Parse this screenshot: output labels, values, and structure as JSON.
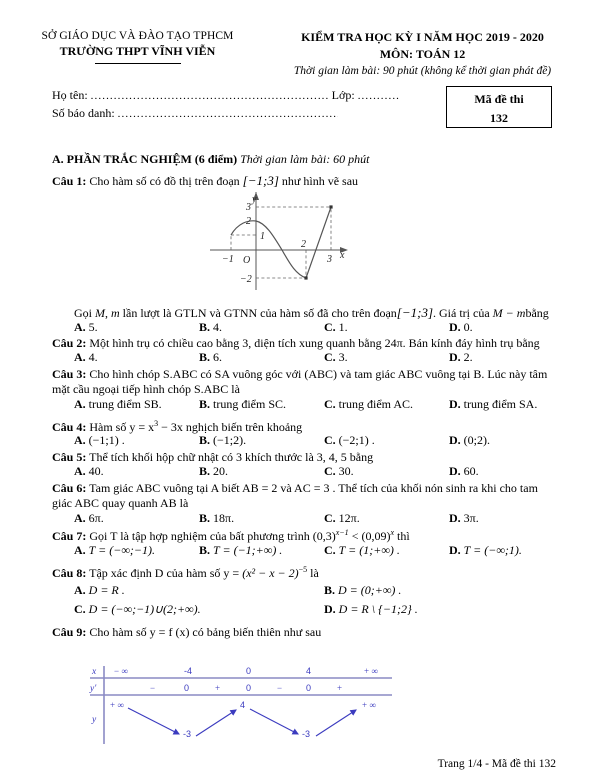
{
  "header": {
    "department": "SỞ GIÁO DỤC VÀ ĐÀO TẠO TPHCM",
    "school": "TRƯỜNG THPT VĨNH VIỄN",
    "exam_title": "KIỂM TRA HỌC KỲ I NĂM HỌC 2019 - 2020",
    "subject": "MÔN: TOÁN 12",
    "duration_note": "Thời gian làm bài: 90 phút (không kể thời gian phát đề)"
  },
  "identity": {
    "name_label": "Họ tên:",
    "class_label": "Lớp:",
    "candidate_label": "Số báo danh:",
    "name_value": "",
    "class_value": "",
    "candidate_value": "",
    "dots": "......................................................................................................................"
  },
  "exam_code_box": {
    "title": "Mã đề thi",
    "code": "132"
  },
  "section": {
    "label": "A. PHẦN TRẮC NGHIỆM (6 điểm)",
    "time": "Thời gian làm bài: 60 phút"
  },
  "questions": [
    {
      "id": "Câu 1:",
      "stem_pre": "Cho hàm số có đồ thị trên đoạn",
      "interval": "[−1;3]",
      "stem_post": "như hình vẽ sau",
      "follow_pre": "Gọi",
      "follow_M": "M",
      "follow_sep": ",",
      "follow_m": "m",
      "follow_mid": "lần lượt là GTLN và GTNN của hàm số đã cho trên đoạn",
      "follow_interval": "[−1;3]",
      "follow_end": ". Giá trị của",
      "follow_expr": "M − m",
      "follow_tail": "bằng",
      "options": [
        {
          "key": "A.",
          "text": "5."
        },
        {
          "key": "B.",
          "text": "4."
        },
        {
          "key": "C.",
          "text": "1."
        },
        {
          "key": "D.",
          "text": "0."
        }
      ]
    },
    {
      "id": "Câu 2:",
      "stem": "Một hình trụ có chiều cao bằng 3, diện tích xung quanh bằng 24π. Bán kính đáy hình trụ bằng",
      "options": [
        {
          "key": "A.",
          "text": "4."
        },
        {
          "key": "B.",
          "text": "6."
        },
        {
          "key": "C.",
          "text": "3."
        },
        {
          "key": "D.",
          "text": "2."
        }
      ]
    },
    {
      "id": "Câu 3:",
      "stem_line1": "Cho hình chóp S.ABC có SA vuông góc với (ABC) và tam giác ABC vuông tại B. Lúc này tâm",
      "stem_line2": "mặt cầu ngoại tiếp hình chóp S.ABC là",
      "options": [
        {
          "key": "A.",
          "text": "trung điểm SB."
        },
        {
          "key": "B.",
          "text": "trung điểm SC."
        },
        {
          "key": "C.",
          "text": "trung điểm AC."
        },
        {
          "key": "D.",
          "text": "trung điểm SA."
        }
      ]
    },
    {
      "id": "Câu 4:",
      "stem_pre": "Hàm số y = x",
      "stem_exp": "3",
      "stem_post": "− 3x  nghịch biến trên khoảng",
      "options": [
        {
          "key": "A.",
          "text": "(−1;1) ."
        },
        {
          "key": "B.",
          "text": "(−1;2)."
        },
        {
          "key": "C.",
          "text": "(−2;1) ."
        },
        {
          "key": "D.",
          "text": "(0;2)."
        }
      ]
    },
    {
      "id": "Câu 5:",
      "stem": "Thể tích khối hộp chữ nhật có 3 khích thước là 3, 4, 5 bằng",
      "options": [
        {
          "key": "A.",
          "text": "40."
        },
        {
          "key": "B.",
          "text": "20."
        },
        {
          "key": "C.",
          "text": "30."
        },
        {
          "key": "D.",
          "text": "60."
        }
      ]
    },
    {
      "id": "Câu 6:",
      "stem_line1": "Tam giác ABC vuông tại A biết  AB = 2  và  AC = 3 . Thể tích của khối nón sinh ra khi cho tam",
      "stem_line2": "giác ABC quay quanh AB là",
      "options": [
        {
          "key": "A.",
          "text": "6π."
        },
        {
          "key": "B.",
          "text": "18π."
        },
        {
          "key": "C.",
          "text": "12π."
        },
        {
          "key": "D.",
          "text": "3π."
        }
      ]
    },
    {
      "id": "Câu 7:",
      "stem_pre": "Gọi T là tập hợp nghiệm của bất phương trình",
      "ineq_base1": "(0,3)",
      "ineq_exp1": "x−1",
      "ineq_rel": "<",
      "ineq_base2": "(0,09)",
      "ineq_exp2": "x",
      "stem_post": "thì",
      "options": [
        {
          "key": "A.",
          "text": "T = (−∞;−1)."
        },
        {
          "key": "B.",
          "text": "T = (−1;+∞) ."
        },
        {
          "key": "C.",
          "text": "T = (1;+∞) ."
        },
        {
          "key": "D.",
          "text": "T = (−∞;1)."
        }
      ]
    },
    {
      "id": "Câu 8:",
      "stem_pre": "Tập xác định  D của hàm số  y =",
      "fn_base": "(x² − x − 2)",
      "fn_exp": "−5",
      "stem_post": "là",
      "options": [
        {
          "key": "A.",
          "text": "D = R ."
        },
        {
          "key": "B.",
          "text": "D = (0;+∞) ."
        },
        {
          "key": "C.",
          "text": "D = (−∞;−1)∪(2;+∞)."
        },
        {
          "key": "D.",
          "text": "D = R \\ {−1;2} ."
        }
      ]
    },
    {
      "id": "Câu 9:",
      "stem_pre": "Cho hàm số  y = f (x)  có bảng biến thiên như sau"
    }
  ],
  "footer": {
    "text": "Trang 1/4 - Mã đề thi 132"
  },
  "chart_data": [
    {
      "type": "line",
      "name": "cau1-graph",
      "title": "",
      "xlabel": "x",
      "ylabel": "y",
      "xlim": [
        -1.6,
        3.9
      ],
      "ylim": [
        -2.8,
        3.7
      ],
      "x_ticks": [
        -1,
        3
      ],
      "x_tick_labels": [
        "−1",
        "3"
      ],
      "y_ticks": [
        -2,
        1,
        2,
        3
      ],
      "y_tick_labels": [
        "−2",
        "1",
        "2",
        "3"
      ],
      "origin_label": "O",
      "inner_label": "2",
      "grid": false,
      "legend": "none",
      "key_points": [
        {
          "x": -1,
          "y": 1,
          "role": "endpoint-left"
        },
        {
          "x": 0,
          "y": 2,
          "role": "local-max"
        },
        {
          "x": 1,
          "y": 0,
          "role": "x-intercept"
        },
        {
          "x": 2,
          "y": -2,
          "role": "local-min"
        },
        {
          "x": 3,
          "y": 3,
          "role": "endpoint-right"
        }
      ],
      "dashed_guides": [
        {
          "from": [
            -1,
            0
          ],
          "to": [
            -1,
            1
          ]
        },
        {
          "from": [
            -1,
            1
          ],
          "to": [
            0,
            1
          ]
        },
        {
          "from": [
            2,
            0
          ],
          "to": [
            2,
            -2
          ]
        },
        {
          "from": [
            0,
            -2
          ],
          "to": [
            2,
            -2
          ]
        },
        {
          "from": [
            3,
            0
          ],
          "to": [
            3,
            3
          ]
        },
        {
          "from": [
            0,
            3
          ],
          "to": [
            3,
            3
          ]
        }
      ],
      "curve_color": "#555555",
      "axis_color": "#555555"
    },
    {
      "type": "table",
      "name": "cau9-variation-table",
      "title": "Bảng biến thiên",
      "row_labels": [
        "x",
        "y'",
        "y"
      ],
      "x_values": [
        "− ∞",
        "-4",
        "0",
        "4",
        "+ ∞"
      ],
      "yprime_values": [
        "−",
        "0",
        "+",
        "0",
        "−",
        "0",
        "+"
      ],
      "y_values": [
        "+ ∞",
        "-3",
        "4",
        "-3",
        "+ ∞"
      ],
      "arrows": [
        {
          "direction": "down",
          "from": "+ ∞",
          "to": "-3"
        },
        {
          "direction": "up",
          "from": "-3",
          "to": "4"
        },
        {
          "direction": "down",
          "from": "4",
          "to": "-3"
        },
        {
          "direction": "up",
          "from": "-3",
          "to": "+ ∞"
        }
      ],
      "accent_color": "#3b3bbf",
      "rule_color": "#8a8ac4"
    }
  ]
}
